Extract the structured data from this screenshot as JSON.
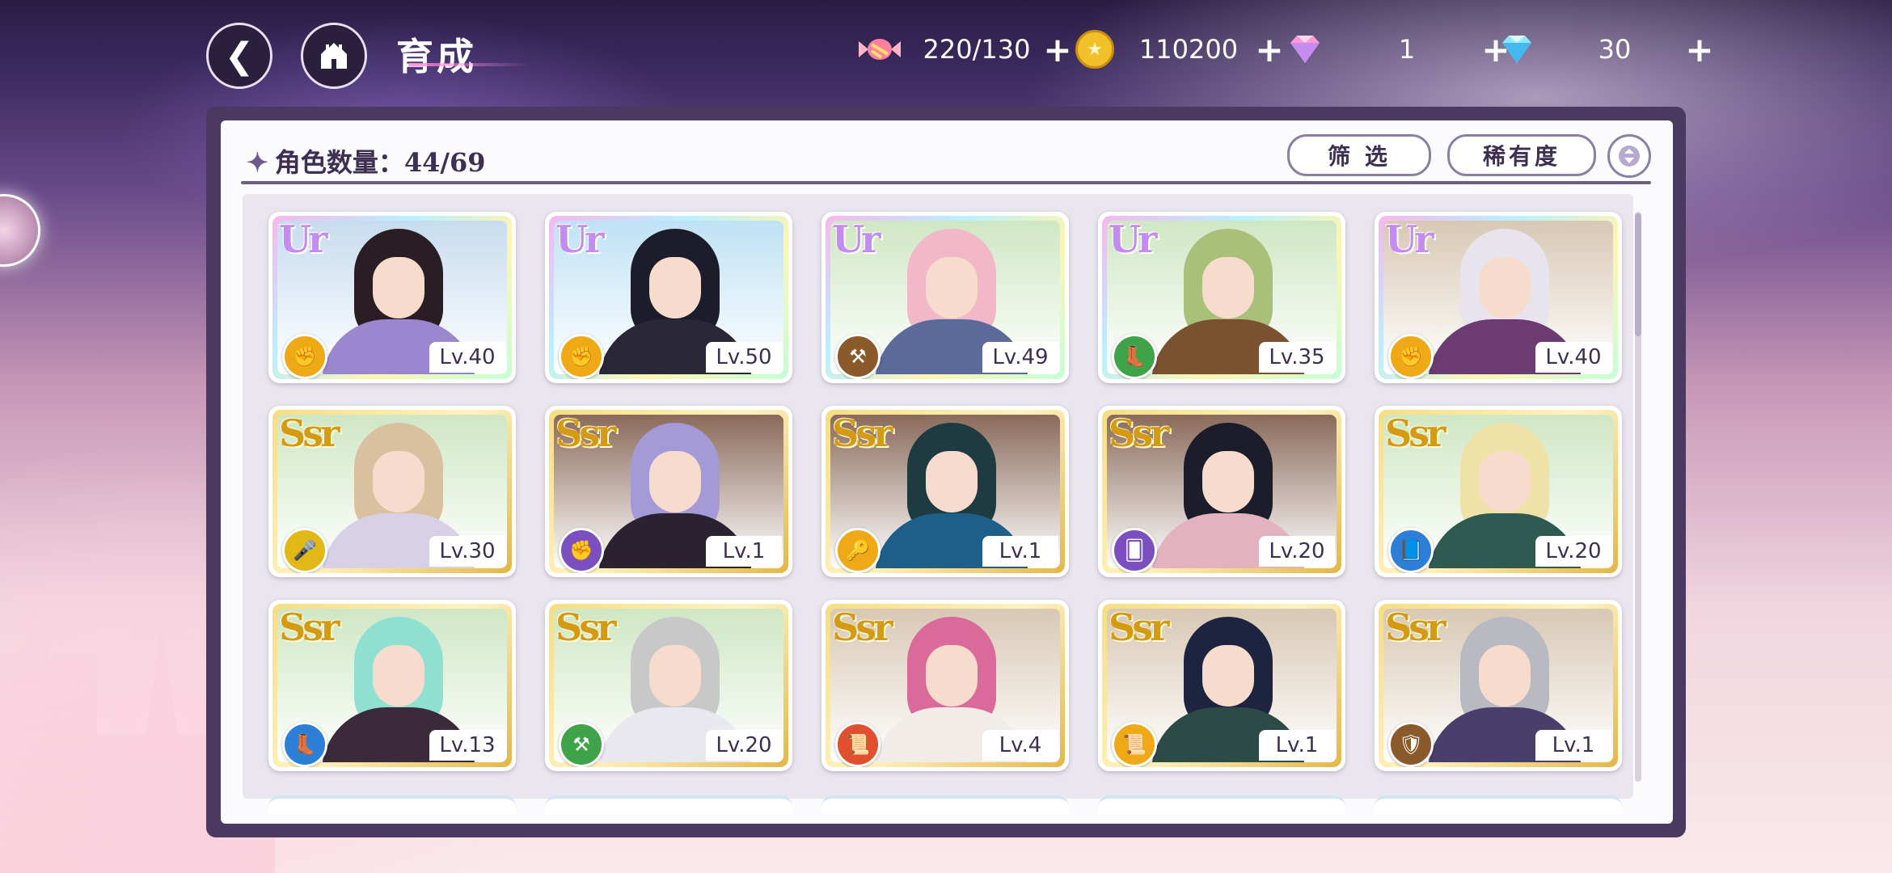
{
  "header": {
    "title": "育成",
    "resources": [
      {
        "icon": "candy-icon",
        "value": "220/130",
        "plus": "+"
      },
      {
        "icon": "coin-icon",
        "value": "110200",
        "plus": "+"
      },
      {
        "icon": "pink-gem-icon",
        "value": "1",
        "plus": "+"
      },
      {
        "icon": "blue-gem-icon",
        "value": "30",
        "plus": "+"
      }
    ]
  },
  "panel": {
    "count_label": "角色数量：44/69",
    "filter_label": "筛 选",
    "rarity_label": "稀有度"
  },
  "colors": {
    "fist": "#f0a916",
    "hammer": "#8a5a2b",
    "boot": "#3fa34a",
    "fist_purple": "#7b4fc0",
    "mic": "#e2b816",
    "key": "#f0a916",
    "cards": "#7b4fc0",
    "book_blue": "#2d7ed6",
    "boot_blue": "#2d7ed6",
    "hammer_green": "#3fa34a",
    "scroll_red": "#e0502f",
    "scroll_orange": "#f0a916",
    "shield": "#8a5a2b"
  },
  "cards": [
    {
      "rarity": "UR",
      "role": "fist",
      "level": "Lv.40",
      "hair": "#2a1d24",
      "outfit": "#9a87d0",
      "sky": "#c7dcef"
    },
    {
      "rarity": "UR",
      "role": "fist",
      "level": "Lv.50",
      "hair": "#1c1c2a",
      "outfit": "#2a2838",
      "sky": "#bfe2f5"
    },
    {
      "rarity": "UR",
      "role": "hammer",
      "level": "Lv.49",
      "hair": "#f2b8c8",
      "outfit": "#5b6a9a",
      "sky": "#cfe7c4"
    },
    {
      "rarity": "UR",
      "role": "boot",
      "level": "Lv.35",
      "hair": "#a9c07a",
      "outfit": "#7a5230",
      "sky": "#cfe7c4"
    },
    {
      "rarity": "UR",
      "role": "fist",
      "level": "Lv.40",
      "hair": "#e8e4ee",
      "outfit": "#6b3b72",
      "sky": "#d8c8b4"
    },
    {
      "rarity": "SSR",
      "role": "mic",
      "level": "Lv.30",
      "hair": "#d9c09e",
      "outfit": "#d8d0e6",
      "sky": "#cfe7c4"
    },
    {
      "rarity": "SSR",
      "role": "fist_purple",
      "level": "Lv.1",
      "hair": "#a49ad8",
      "outfit": "#2a2230",
      "sky": "#8a6a5a"
    },
    {
      "rarity": "SSR",
      "role": "key",
      "level": "Lv.1",
      "hair": "#1f3b42",
      "outfit": "#1e5f8a",
      "sky": "#8a6a5a"
    },
    {
      "rarity": "SSR",
      "role": "cards",
      "level": "Lv.20",
      "hair": "#1c1c2a",
      "outfit": "#e3b2c0",
      "sky": "#8a6a5a"
    },
    {
      "rarity": "SSR",
      "role": "book_blue",
      "level": "Lv.20",
      "hair": "#efe2a8",
      "outfit": "#2e5a52",
      "sky": "#cfe7c4"
    },
    {
      "rarity": "SSR",
      "role": "boot_blue",
      "level": "Lv.13",
      "hair": "#8fe0d0",
      "outfit": "#3a2a3a",
      "sky": "#cfe7c4"
    },
    {
      "rarity": "SSR",
      "role": "hammer_green",
      "level": "Lv.20",
      "hair": "#c8c8c8",
      "outfit": "#e8e8ee",
      "sky": "#cfe7c4"
    },
    {
      "rarity": "SSR",
      "role": "scroll_red",
      "level": "Lv.4",
      "hair": "#d96a9a",
      "outfit": "#f2ece8",
      "sky": "#d8c8b4"
    },
    {
      "rarity": "SSR",
      "role": "scroll_orange",
      "level": "Lv.1",
      "hair": "#1e2440",
      "outfit": "#2c4a46",
      "sky": "#d8c8b4"
    },
    {
      "rarity": "SSR",
      "role": "shield",
      "level": "Lv.1",
      "hair": "#b9b9c2",
      "outfit": "#4a3e6a",
      "sky": "#d8c8b4"
    }
  ]
}
